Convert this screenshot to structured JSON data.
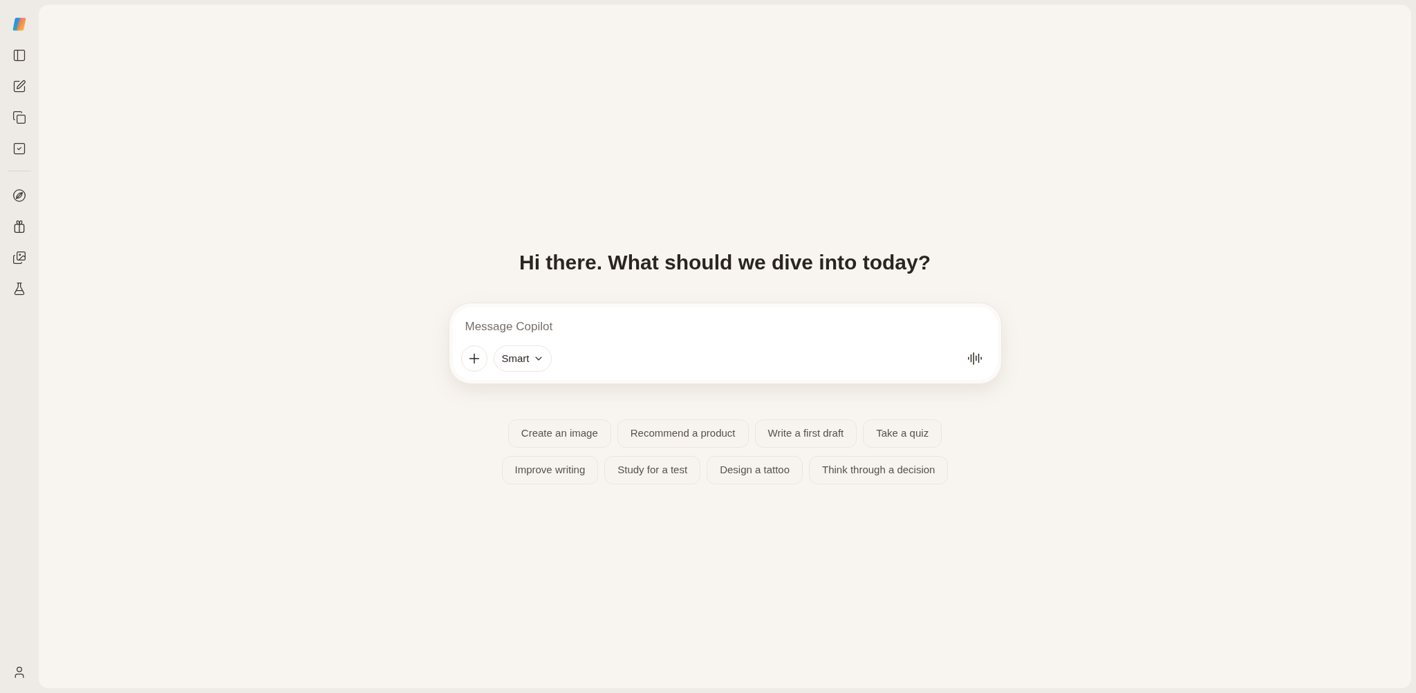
{
  "greeting": "Hi there. What should we dive into today?",
  "composer": {
    "placeholder": "Message Copilot",
    "mode": "Smart"
  },
  "suggestion_rows": [
    [
      "Create an image",
      "Recommend a product",
      "Write a first draft",
      "Take a quiz"
    ],
    [
      "Improve writing",
      "Study for a test",
      "Design a tattoo",
      "Think through a decision"
    ]
  ]
}
